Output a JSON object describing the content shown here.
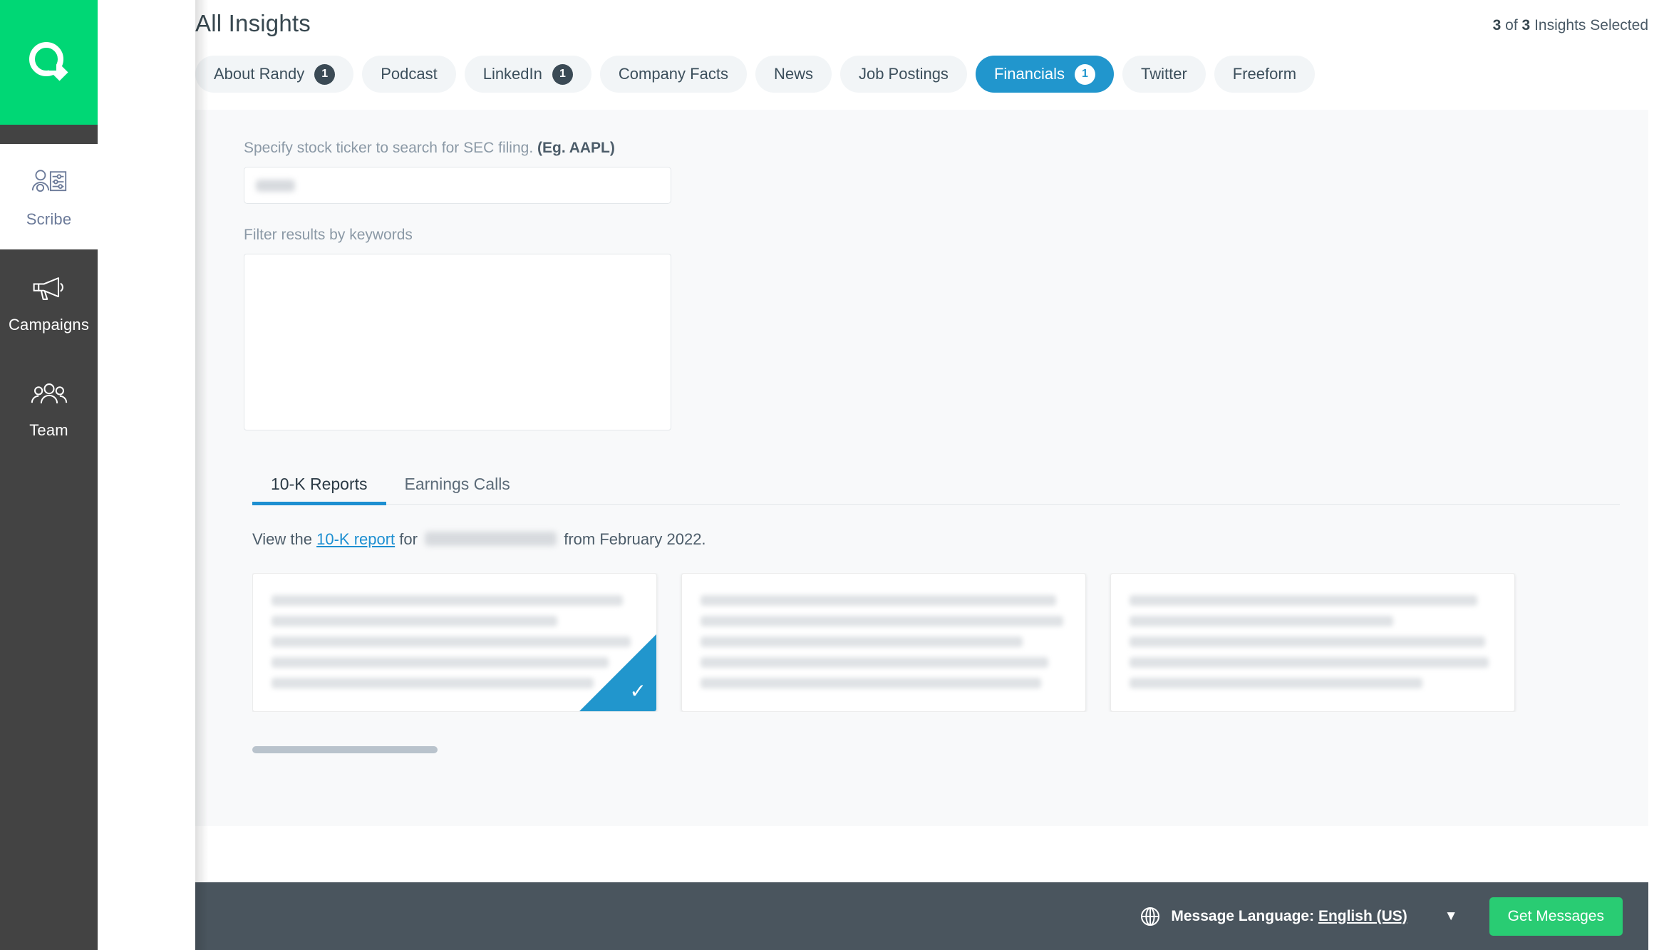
{
  "sidebar": {
    "logo_name": "quill-q-logo",
    "logo_color": "#00D775",
    "items": [
      {
        "label": "Scribe",
        "icon": "person-settings-icon",
        "active": true
      },
      {
        "label": "Campaigns",
        "icon": "megaphone-icon",
        "active": false
      },
      {
        "label": "Team",
        "icon": "people-group-icon",
        "active": false
      }
    ]
  },
  "header": {
    "title": "All Insights",
    "selected_prefix": "3",
    "selected_middle": "of",
    "selected_total": "3",
    "selected_suffix": "Insights Selected"
  },
  "tabs": [
    {
      "label": "About Randy",
      "badge": "1",
      "selected": false
    },
    {
      "label": "Podcast",
      "badge": null,
      "selected": false
    },
    {
      "label": "LinkedIn",
      "badge": "1",
      "selected": false
    },
    {
      "label": "Company Facts",
      "badge": null,
      "selected": false
    },
    {
      "label": "News",
      "badge": null,
      "selected": false
    },
    {
      "label": "Job Postings",
      "badge": null,
      "selected": false
    },
    {
      "label": "Financials",
      "badge": "1",
      "selected": true
    },
    {
      "label": "Twitter",
      "badge": null,
      "selected": false
    },
    {
      "label": "Freeform",
      "badge": null,
      "selected": false
    }
  ],
  "form": {
    "ticker_label_main": "Specify stock ticker to search for SEC filing.",
    "ticker_label_example": "(Eg. AAPL)",
    "ticker_value": "",
    "ticker_placeholder": "",
    "keywords_label": "Filter results by keywords",
    "keywords_value": ""
  },
  "subtabs": [
    {
      "label": "10-K Reports",
      "active": true
    },
    {
      "label": "Earnings Calls",
      "active": false
    }
  ],
  "report_line": {
    "prefix": "View the",
    "link": "10-K report",
    "middle": "for",
    "company": "",
    "suffix": "from February 2022."
  },
  "cards": [
    {
      "text": "",
      "selected": true,
      "lines": [
        96,
        78,
        98,
        92,
        88
      ]
    },
    {
      "text": "",
      "selected": false,
      "lines": [
        97,
        99,
        88,
        95,
        93
      ]
    },
    {
      "text": "",
      "selected": false,
      "lines": [
        95,
        72,
        97,
        98,
        80
      ]
    }
  ],
  "scrollbar": {
    "name": "cards-horizontal-scrollbar"
  },
  "bottom_bar": {
    "globe_icon": "globe-icon",
    "language_label": "Message Language:",
    "language_value": "English (US)",
    "caret": "▼",
    "get_messages_label": "Get Messages",
    "accent_green": "#29cc73"
  },
  "colors": {
    "brand_green": "#00D775",
    "selected_blue": "#2196cd",
    "sidebar_dark": "#434343",
    "bottom_bar": "#4a555e"
  }
}
